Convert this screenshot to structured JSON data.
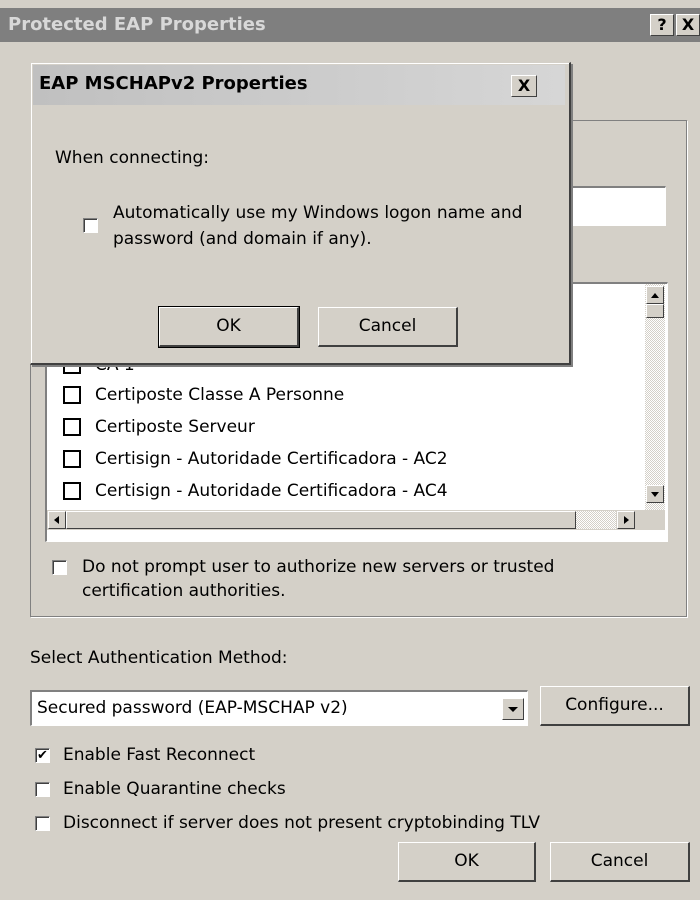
{
  "outer": {
    "title": "Protected EAP Properties",
    "help_label": "?",
    "close_label": "X",
    "cert_list": [
      "CA 1",
      "Certiposte Classe A Personne",
      "Certiposte Serveur",
      "Certisign - Autoridade Certificadora - AC2",
      "Certisign - Autoridade Certificadora - AC4"
    ],
    "no_prompt_line1": "Do not prompt user to authorize new servers or trusted",
    "no_prompt_line2": "certification authorities.",
    "auth_method_label": "Select Authentication Method:",
    "auth_method_value": "Secured password (EAP-MSCHAP v2)",
    "configure_label": "Configure...",
    "options": [
      {
        "label": "Enable Fast Reconnect",
        "checked": true
      },
      {
        "label": "Enable Quarantine checks",
        "checked": false
      },
      {
        "label": "Disconnect if server does not present cryptobinding TLV",
        "checked": false
      }
    ],
    "ok_label": "OK",
    "cancel_label": "Cancel"
  },
  "inner": {
    "title": "EAP MSCHAPv2 Properties",
    "close_label": "X",
    "when_connecting": "When connecting:",
    "auto_logon_line1": "Automatically use my Windows logon name and",
    "auto_logon_line2": "password (and domain if any).",
    "auto_logon_checked": false,
    "ok_label": "OK",
    "cancel_label": "Cancel"
  },
  "colors": {
    "face": "#d4d0c8",
    "inactive_title": "#7f7f7f",
    "white": "#ffffff"
  }
}
